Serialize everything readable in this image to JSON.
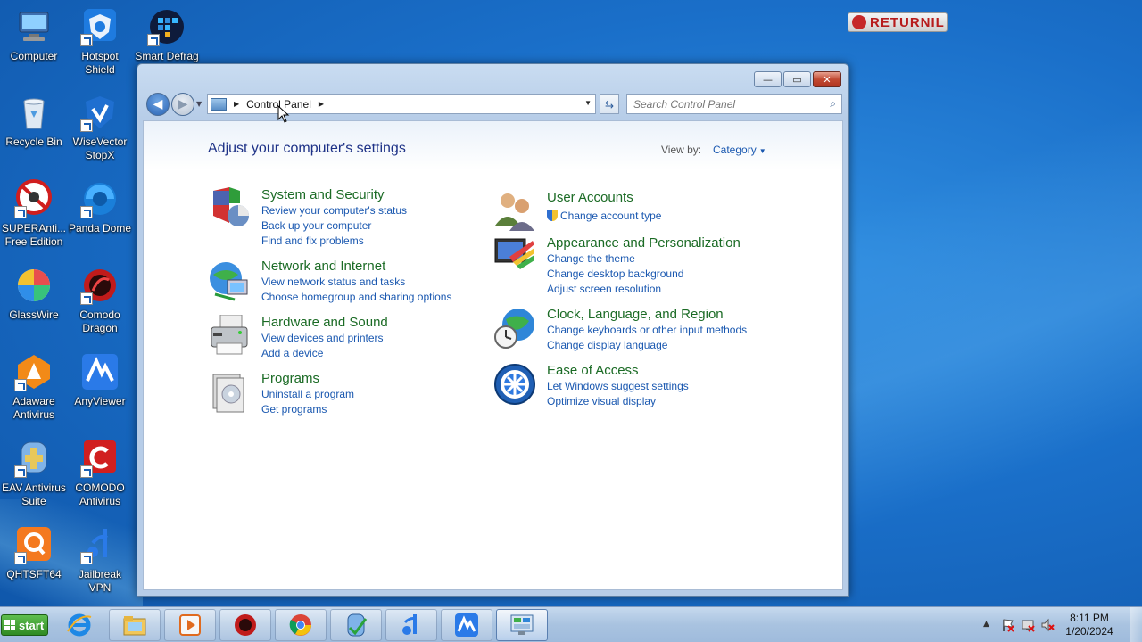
{
  "desktop": {
    "icons": [
      {
        "label": "Computer",
        "icon": "computer-icon"
      },
      {
        "label": "Hotspot Shield",
        "icon": "hotspot-shield-icon"
      },
      {
        "label": "Smart Defrag",
        "icon": "smart-defrag-icon"
      },
      {
        "label": "Recycle Bin",
        "icon": "recycle-bin-icon"
      },
      {
        "label": "WiseVector StopX",
        "icon": "wisevector-icon"
      },
      {
        "label": "SUPERAnti... Free Edition",
        "icon": "superantispyware-icon"
      },
      {
        "label": "Panda Dome",
        "icon": "panda-dome-icon"
      },
      {
        "label": "GlassWire",
        "icon": "glasswire-icon"
      },
      {
        "label": "Comodo Dragon",
        "icon": "comodo-dragon-icon"
      },
      {
        "label": "Adaware Antivirus",
        "icon": "adaware-icon"
      },
      {
        "label": "AnyViewer",
        "icon": "anyviewer-icon"
      },
      {
        "label": "EAV Antivirus Suite",
        "icon": "eav-antivirus-icon"
      },
      {
        "label": "COMODO Antivirus",
        "icon": "comodo-antivirus-icon"
      },
      {
        "label": "QHTSFT64",
        "icon": "qhtsft64-icon"
      },
      {
        "label": "Jailbreak VPN",
        "icon": "jailbreak-vpn-icon"
      }
    ],
    "badge": "RETURNIL"
  },
  "window": {
    "controls": {
      "minimize": "—",
      "maximize": "▭",
      "close": "✕"
    },
    "address": {
      "crumb": "Control Panel"
    },
    "search": {
      "placeholder": "Search Control Panel"
    },
    "heading": "Adjust your computer's settings",
    "view_by_label": "View by:",
    "view_by_value": "Category",
    "categories_left": [
      {
        "title": "System and Security",
        "icon": "system-security-icon",
        "links": [
          "Review your computer's status",
          "Back up your computer",
          "Find and fix problems"
        ]
      },
      {
        "title": "Network and Internet",
        "icon": "network-internet-icon",
        "links": [
          "View network status and tasks",
          "Choose homegroup and sharing options"
        ]
      },
      {
        "title": "Hardware and Sound",
        "icon": "hardware-sound-icon",
        "links": [
          "View devices and printers",
          "Add a device"
        ]
      },
      {
        "title": "Programs",
        "icon": "programs-icon",
        "links": [
          "Uninstall a program",
          "Get programs"
        ]
      }
    ],
    "categories_right": [
      {
        "title": "User Accounts",
        "icon": "user-accounts-icon",
        "links": [
          "Change account type"
        ]
      },
      {
        "title": "Appearance and Personalization",
        "icon": "appearance-icon",
        "links": [
          "Change the theme",
          "Change desktop background",
          "Adjust screen resolution"
        ]
      },
      {
        "title": "Clock, Language, and Region",
        "icon": "clock-language-icon",
        "links": [
          "Change keyboards or other input methods",
          "Change display language"
        ]
      },
      {
        "title": "Ease of Access",
        "icon": "ease-of-access-icon",
        "links": [
          "Let Windows suggest settings",
          "Optimize visual display"
        ]
      }
    ]
  },
  "taskbar": {
    "start_label": "start",
    "items": [
      "internet-explorer-icon",
      "file-explorer-icon",
      "media-player-icon",
      "comodo-dragon-icon",
      "chrome-icon",
      "eav-antivirus-icon",
      "jailbreak-vpn-icon",
      "anyviewer-icon",
      "control-panel-icon"
    ],
    "time": "8:11 PM",
    "date": "1/20/2024"
  }
}
